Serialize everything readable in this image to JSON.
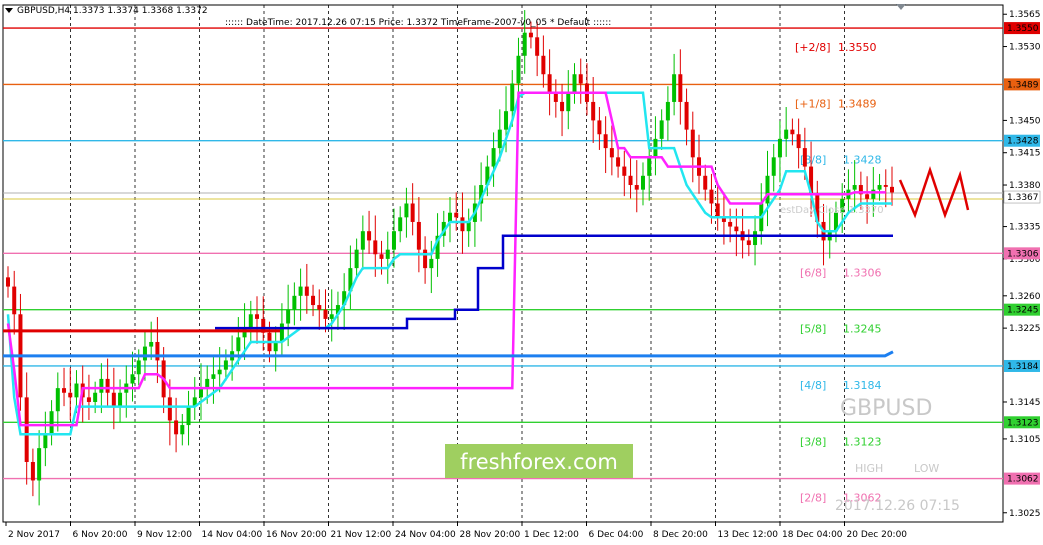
{
  "header": {
    "symbol_line": "GBPUSD,H4  1.3373 1.3374 1.3368 1.3372",
    "info_line": ":::::: DateTime: 2017.12.26 07:15    Price: 1.3372    TimeFrame-2007-v0_05    *  Default  ::::::"
  },
  "watermark": {
    "symbol": "GBPUSD",
    "brand": "freshforex.com",
    "high_label": "HIGH",
    "low_label": "LOW",
    "datetime": "2017.12.26 07:15",
    "ghost_text": "estDay Close 1.3370"
  },
  "colors": {
    "background": "#ffffff",
    "candle_up": "#00c000",
    "candle_down": "#e00000",
    "cyan_line": "#22e6f0",
    "magenta_line": "#ff22ff",
    "navy_line": "#0000cc",
    "blue_line": "#1c7ff0",
    "brand_bg": "#9fcf60"
  },
  "chart_data": {
    "type": "candlestick",
    "symbol": "GBPUSD",
    "timeframe": "H4",
    "ylim": [
      1.3015,
      1.3575
    ],
    "y_ticks": [
      "1.3565",
      "1.3550",
      "1.3530",
      "1.3489",
      "1.3450",
      "1.3428",
      "1.3415",
      "1.3380",
      "1.3367",
      "1.3335",
      "1.3306",
      "1.3300",
      "1.3260",
      "1.3245",
      "1.3225",
      "1.3184",
      "1.3145",
      "1.3123",
      "1.3105",
      "1.3062",
      "1.3025"
    ],
    "x_ticks": [
      "2 Nov 2017",
      "6 Nov 20:00",
      "9 Nov 12:00",
      "14 Nov 04:00",
      "16 Nov 20:00",
      "21 Nov 12:00",
      "24 Nov 04:00",
      "28 Nov 20:00",
      "1 Dec 12:00",
      "6 Dec 04:00",
      "8 Dec 20:00",
      "13 Dec 12:00",
      "18 Dec 04:00",
      "20 Dec 20:00"
    ],
    "bid_price": "1.3367",
    "levels": [
      {
        "name": "[+2/8]",
        "value": "1.3550",
        "color": "#e00000"
      },
      {
        "name": "[+1/8]",
        "value": "1.3489",
        "color": "#e86010"
      },
      {
        "name": "[8/8]",
        "value": "1.3428",
        "color": "#30b8e8"
      },
      {
        "name": "[6/8]",
        "value": "1.3306",
        "color": "#f070b0"
      },
      {
        "name": "[5/8]",
        "value": "1.3245",
        "color": "#30d030"
      },
      {
        "name": "[4/8]",
        "value": "1.3184",
        "color": "#30b8e8"
      },
      {
        "name": "[3/8]",
        "value": "1.3123",
        "color": "#30d030"
      },
      {
        "name": "[2/8]",
        "value": "1.3062",
        "color": "#f070b0"
      }
    ],
    "close_path": [
      1.327,
      1.324,
      1.315,
      1.308,
      1.306,
      1.3095,
      1.311,
      1.3135,
      1.316,
      1.3155,
      1.315,
      1.3165,
      1.315,
      1.3145,
      1.3155,
      1.317,
      1.3155,
      1.314,
      1.3155,
      1.3165,
      1.3175,
      1.319,
      1.3205,
      1.321,
      1.319,
      1.315,
      1.3125,
      1.311,
      1.312,
      1.314,
      1.315,
      1.316,
      1.317,
      1.3175,
      1.318,
      1.319,
      1.32,
      1.3215,
      1.3225,
      1.324,
      1.3235,
      1.322,
      1.32,
      1.321,
      1.323,
      1.3245,
      1.326,
      1.327,
      1.326,
      1.325,
      1.3245,
      1.3235,
      1.324,
      1.325,
      1.3265,
      1.329,
      1.331,
      1.333,
      1.332,
      1.3305,
      1.33,
      1.331,
      1.333,
      1.3345,
      1.336,
      1.334,
      1.331,
      1.329,
      1.33,
      1.3325,
      1.334,
      1.335,
      1.3345,
      1.333,
      1.334,
      1.336,
      1.338,
      1.34,
      1.342,
      1.344,
      1.346,
      1.349,
      1.352,
      1.3545,
      1.354,
      1.352,
      1.35,
      1.348,
      1.347,
      1.346,
      1.348,
      1.35,
      1.349,
      1.347,
      1.345,
      1.3435,
      1.342,
      1.341,
      1.34,
      1.339,
      1.338,
      1.3375,
      1.339,
      1.341,
      1.343,
      1.345,
      1.347,
      1.35,
      1.347,
      1.344,
      1.341,
      1.339,
      1.3375,
      1.336,
      1.3345,
      1.334,
      1.3335,
      1.333,
      1.332,
      1.3315,
      1.333,
      1.336,
      1.339,
      1.341,
      1.343,
      1.344,
      1.3435,
      1.342,
      1.34,
      1.337,
      1.334,
      1.332,
      1.333,
      1.335,
      1.3365,
      1.3375,
      1.338,
      1.337,
      1.3365,
      1.3375,
      1.338,
      1.3378,
      1.3372
    ],
    "cyan_steps": [
      1.324,
      1.315,
      1.311,
      1.311,
      1.311,
      1.311,
      1.311,
      1.311,
      1.311,
      1.311,
      1.311,
      1.314,
      1.314,
      1.314,
      1.314,
      1.314,
      1.314,
      1.314,
      1.314,
      1.314,
      1.314,
      1.314,
      1.314,
      1.314,
      1.314,
      1.314,
      1.314,
      1.314,
      1.314,
      1.314,
      1.314,
      1.3145,
      1.315,
      1.3155,
      1.316,
      1.317,
      1.318,
      1.319,
      1.32,
      1.321,
      1.321,
      1.321,
      1.321,
      1.321,
      1.321,
      1.3215,
      1.322,
      1.3225,
      1.3225,
      1.3225,
      1.3225,
      1.3225,
      1.323,
      1.324,
      1.325,
      1.3265,
      1.328,
      1.329,
      1.329,
      1.329,
      1.329,
      1.329,
      1.33,
      1.3305,
      1.3305,
      1.3305,
      1.3305,
      1.3305,
      1.3305,
      1.332,
      1.333,
      1.334,
      1.334,
      1.334,
      1.334,
      1.335,
      1.3365,
      1.338,
      1.3395,
      1.341,
      1.343,
      1.345,
      1.3475,
      1.348,
      1.348,
      1.348,
      1.348,
      1.348,
      1.348,
      1.348,
      1.348,
      1.348,
      1.348,
      1.348,
      1.348,
      1.348,
      1.348,
      1.348,
      1.348,
      1.348,
      1.348,
      1.348,
      1.348,
      1.342,
      1.342,
      1.342,
      1.342,
      1.342,
      1.34,
      1.338,
      1.337,
      1.336,
      1.335,
      1.3345,
      1.3345,
      1.3345,
      1.3345,
      1.3345,
      1.3345,
      1.3345,
      1.3345,
      1.3345,
      1.3355,
      1.3365,
      1.3375,
      1.3395,
      1.3395,
      1.3395,
      1.3395,
      1.337,
      1.334,
      1.333,
      1.333,
      1.333,
      1.334,
      1.335,
      1.3355,
      1.336,
      1.336,
      1.336,
      1.336,
      1.336,
      1.336
    ],
    "magenta_steps": [
      1.323,
      1.318,
      1.312,
      1.312,
      1.312,
      1.312,
      1.312,
      1.312,
      1.312,
      1.312,
      1.312,
      1.312,
      1.316,
      1.316,
      1.316,
      1.316,
      1.316,
      1.316,
      1.316,
      1.316,
      1.316,
      1.316,
      1.3175,
      1.3175,
      1.3175,
      1.317,
      1.316,
      1.316,
      1.316,
      1.316,
      1.316,
      1.316,
      1.316,
      1.316,
      1.316,
      1.316,
      1.316,
      1.316,
      1.316,
      1.316,
      1.316,
      1.316,
      1.316,
      1.316,
      1.316,
      1.316,
      1.316,
      1.316,
      1.316,
      1.316,
      1.316,
      1.316,
      1.316,
      1.316,
      1.316,
      1.316,
      1.316,
      1.316,
      1.316,
      1.316,
      1.316,
      1.316,
      1.316,
      1.316,
      1.316,
      1.316,
      1.316,
      1.316,
      1.316,
      1.316,
      1.316,
      1.316,
      1.316,
      1.316,
      1.316,
      1.316,
      1.316,
      1.316,
      1.316,
      1.316,
      1.316,
      1.316,
      1.348,
      1.348,
      1.348,
      1.348,
      1.348,
      1.348,
      1.348,
      1.348,
      1.348,
      1.348,
      1.348,
      1.348,
      1.348,
      1.348,
      1.348,
      1.345,
      1.342,
      1.342,
      1.341,
      1.341,
      1.341,
      1.341,
      1.341,
      1.341,
      1.34,
      1.34,
      1.34,
      1.34,
      1.34,
      1.34,
      1.34,
      1.34,
      1.338,
      1.337,
      1.336,
      1.336,
      1.336,
      1.336,
      1.336,
      1.336,
      1.337,
      1.337,
      1.337,
      1.337,
      1.337,
      1.337,
      1.337,
      1.337,
      1.337,
      1.337,
      1.337,
      1.337,
      1.337,
      1.337,
      1.3372,
      1.3372,
      1.3372,
      1.3372,
      1.3372,
      1.3372
    ]
  }
}
